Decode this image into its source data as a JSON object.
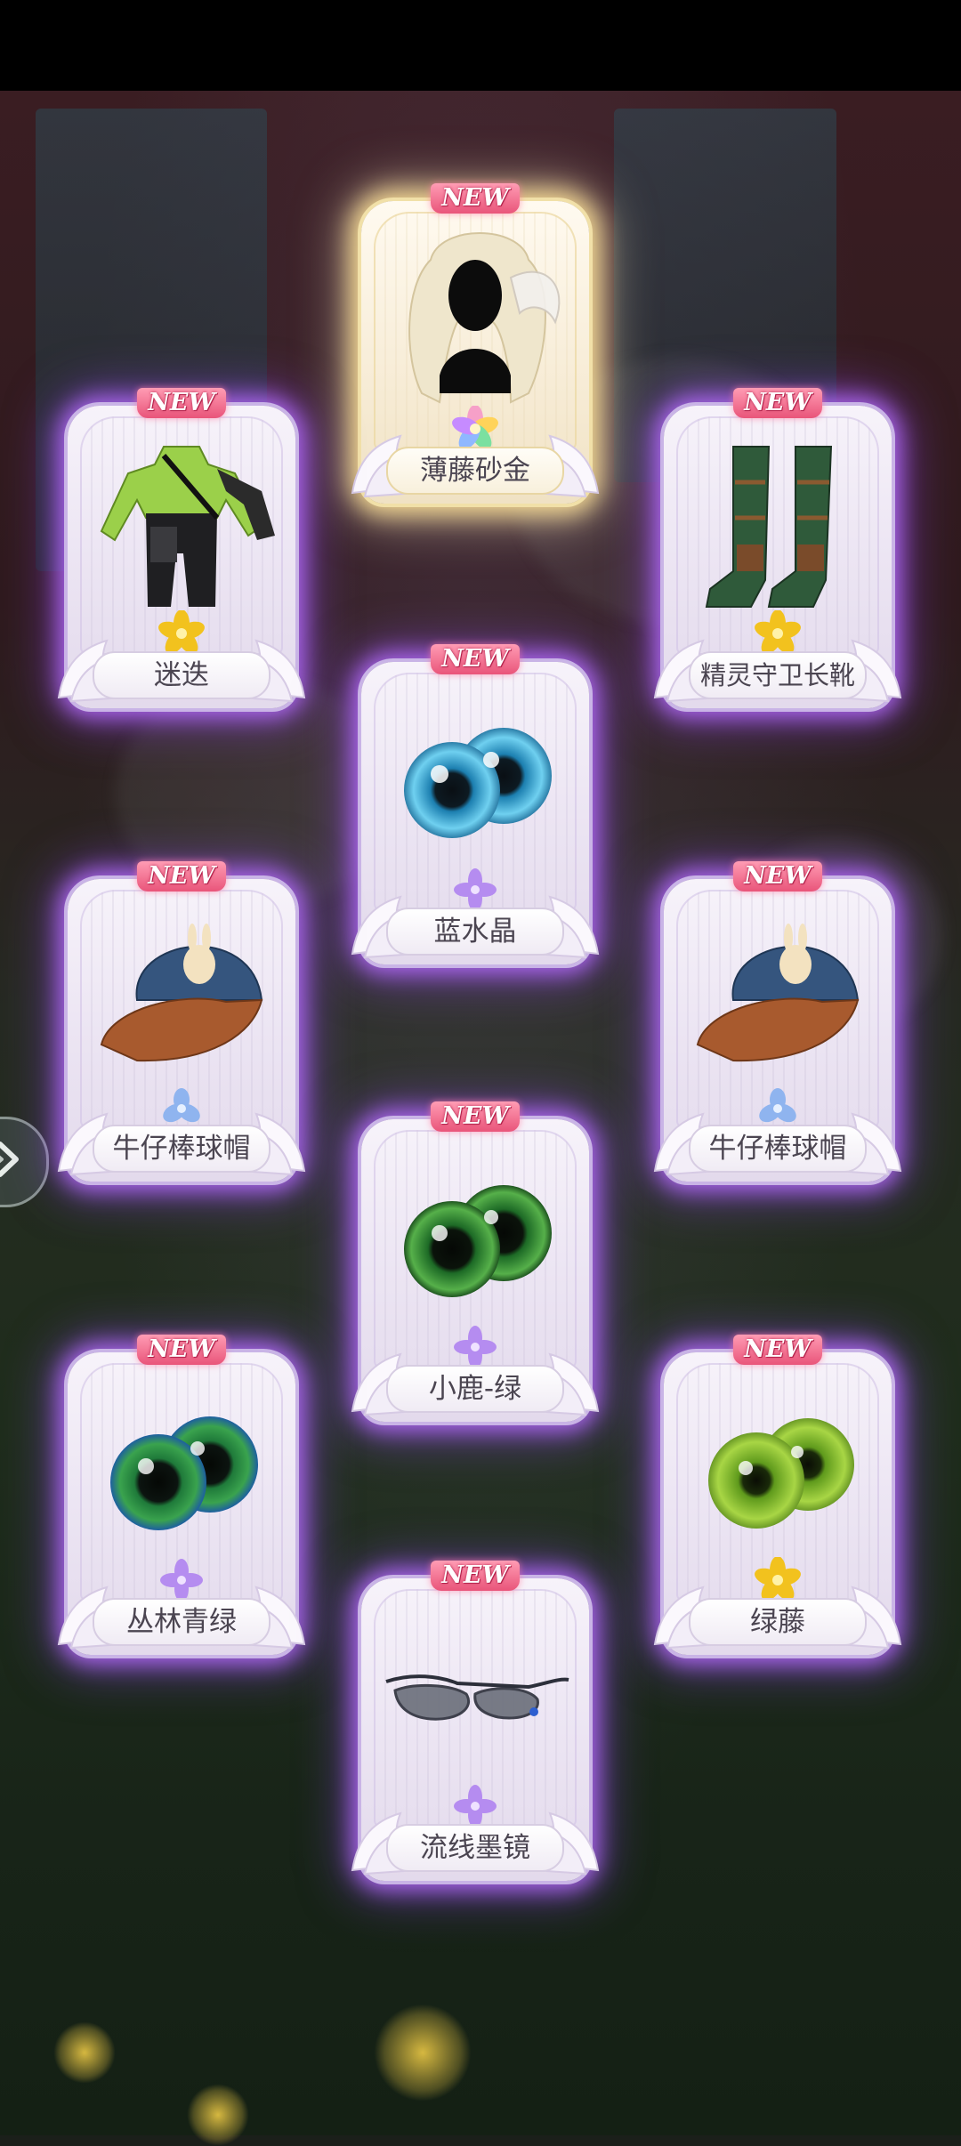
{
  "cards": [
    {
      "name": "薄藤砂金",
      "badge": "NEW",
      "rarity": "gold-flower-multicolor",
      "icon": "hair-icon",
      "glow": "gold"
    },
    {
      "name": "迷迭",
      "badge": "NEW",
      "rarity": "yellow-star-flower",
      "icon": "outfit-icon",
      "glow": "purple"
    },
    {
      "name": "精灵守卫长靴",
      "badge": "NEW",
      "rarity": "yellow-star-flower",
      "icon": "boots-icon",
      "glow": "purple"
    },
    {
      "name": "蓝水晶",
      "badge": "NEW",
      "rarity": "purple-flower",
      "icon": "eyes-blue-icon",
      "glow": "purple"
    },
    {
      "name": "牛仔棒球帽",
      "badge": "NEW",
      "rarity": "blue-flower",
      "icon": "cap-icon",
      "glow": "purple"
    },
    {
      "name": "牛仔棒球帽",
      "badge": "NEW",
      "rarity": "blue-flower",
      "icon": "cap-icon",
      "glow": "purple"
    },
    {
      "name": "小鹿-绿",
      "badge": "NEW",
      "rarity": "purple-flower",
      "icon": "eyes-green-icon",
      "glow": "purple"
    },
    {
      "name": "丛林青绿",
      "badge": "NEW",
      "rarity": "purple-flower",
      "icon": "eyes-teal-icon",
      "glow": "purple"
    },
    {
      "name": "绿藤",
      "badge": "NEW",
      "rarity": "yellow-star-flower",
      "icon": "eyes-lime-icon",
      "glow": "purple"
    },
    {
      "name": "流线墨镜",
      "badge": "NEW",
      "rarity": "purple-flower",
      "icon": "glasses-icon",
      "glow": "purple"
    }
  ],
  "colors": {
    "purple_glow": "#b96eff",
    "gold_glow": "#ffe296",
    "new_badge": "#e9557a"
  }
}
